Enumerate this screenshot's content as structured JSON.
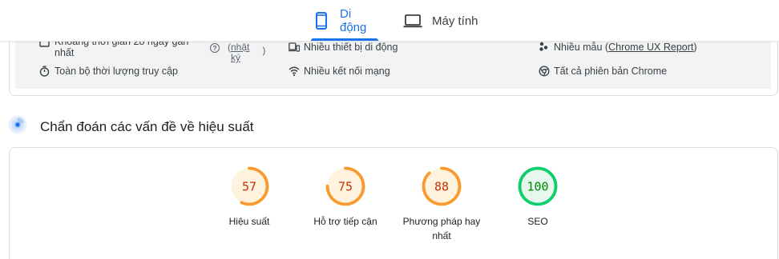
{
  "tabs": {
    "mobile_label": "Di động",
    "desktop_label": "Máy tính"
  },
  "info_panel": {
    "period_line1": "Khoảng thời gian 28 ngày gần",
    "period_line2": "nhất",
    "log_line1": "nhật",
    "log_line2": "ký",
    "duration": "Toàn bộ thời lượng truy cập",
    "devices": "Nhiều thiết bị di động",
    "network": "Nhiều kết nối mạng",
    "samples_prefix": "Nhiều mẫu (",
    "samples_link": "Chrome UX Report",
    "samples_suffix": ")",
    "versions": "Tất cả phiên bản Chrome"
  },
  "diagnostics": {
    "title": "Chẩn đoán các vấn đề về hiệu suất"
  },
  "scores": [
    {
      "value": "57",
      "label": "Hiệu suất",
      "label2": "",
      "fraction": 0.57,
      "color": "#fa9a2e",
      "text_color": "#c33300",
      "bg": "#fff3e0"
    },
    {
      "value": "75",
      "label": "Hỗ trợ tiếp cận",
      "label2": "",
      "fraction": 0.75,
      "color": "#fa9a2e",
      "text_color": "#c33300",
      "bg": "#fff3e0"
    },
    {
      "value": "88",
      "label": "Phương pháp hay",
      "label2": "nhất",
      "fraction": 0.88,
      "color": "#fa9a2e",
      "text_color": "#c33300",
      "bg": "#fff3e0"
    },
    {
      "value": "100",
      "label": "SEO",
      "label2": "",
      "fraction": 1.0,
      "color": "#0cce6b",
      "text_color": "#008800",
      "bg": "#e6f8ee"
    }
  ],
  "colors": {
    "accent": "#1a73e8",
    "average": "#fa9a2e",
    "pass": "#0cce6b"
  }
}
